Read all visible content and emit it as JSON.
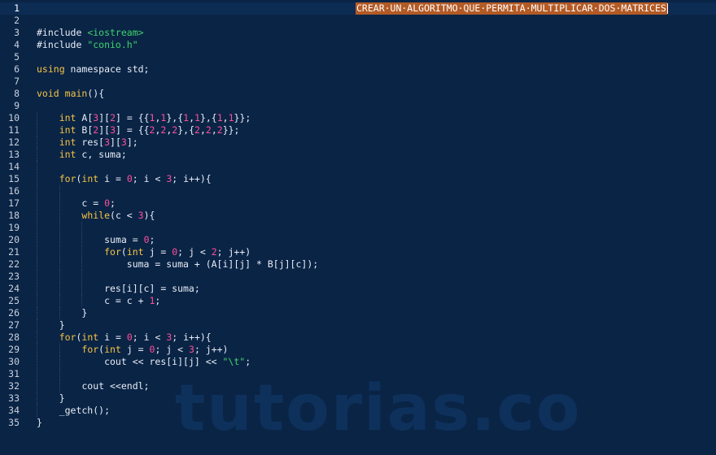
{
  "editor": {
    "selected_comment": "CREAR·UN·ALGORITMO·QUE·PERMITA·MULTIPLICAR·DOS·MATRICES",
    "watermark": "tutorias.co",
    "lines": [
      {
        "n": "1",
        "current": true,
        "html": ""
      },
      {
        "n": "2",
        "html": ""
      },
      {
        "n": "3",
        "html": "<span class=\"pp\">#include </span><span class=\"str\">&lt;iostream&gt;</span>"
      },
      {
        "n": "4",
        "html": "<span class=\"pp\">#include </span><span class=\"str\">\"conio.h\"</span>"
      },
      {
        "n": "5",
        "html": ""
      },
      {
        "n": "6",
        "html": "<span class=\"kw\">using</span> namespace std;"
      },
      {
        "n": "7",
        "html": ""
      },
      {
        "n": "8",
        "html": "<span class=\"kw\">void</span> <span class=\"kw\">main</span>(){"
      },
      {
        "n": "9",
        "html": ""
      },
      {
        "n": "10",
        "guides": 1,
        "html": "    <span class=\"kw\">int</span> A[<span class=\"num\">3</span>][<span class=\"num\">2</span>] = {{<span class=\"num\">1</span>,<span class=\"num\">1</span>},{<span class=\"num\">1</span>,<span class=\"num\">1</span>},{<span class=\"num\">1</span>,<span class=\"num\">1</span>}};"
      },
      {
        "n": "11",
        "guides": 1,
        "html": "    <span class=\"kw\">int</span> B[<span class=\"num\">2</span>][<span class=\"num\">3</span>] = {{<span class=\"num\">2</span>,<span class=\"num\">2</span>,<span class=\"num\">2</span>},{<span class=\"num\">2</span>,<span class=\"num\">2</span>,<span class=\"num\">2</span>}};"
      },
      {
        "n": "12",
        "guides": 1,
        "html": "    <span class=\"kw\">int</span> res[<span class=\"num\">3</span>][<span class=\"num\">3</span>];"
      },
      {
        "n": "13",
        "guides": 1,
        "html": "    <span class=\"kw\">int</span> c, suma;"
      },
      {
        "n": "14",
        "guides": 1,
        "html": ""
      },
      {
        "n": "15",
        "guides": 1,
        "html": "    <span class=\"kw\">for</span>(<span class=\"kw\">int</span> i = <span class=\"num\">0</span>; i &lt; <span class=\"num\">3</span>; i++){"
      },
      {
        "n": "16",
        "guides": 2,
        "html": ""
      },
      {
        "n": "17",
        "guides": 2,
        "html": "        c = <span class=\"num\">0</span>;"
      },
      {
        "n": "18",
        "guides": 2,
        "html": "        <span class=\"kw\">while</span>(c &lt; <span class=\"num\">3</span>){"
      },
      {
        "n": "19",
        "guides": 3,
        "html": ""
      },
      {
        "n": "20",
        "guides": 3,
        "html": "            suma = <span class=\"num\">0</span>;"
      },
      {
        "n": "21",
        "guides": 3,
        "html": "            <span class=\"kw\">for</span>(<span class=\"kw\">int</span> j = <span class=\"num\">0</span>; j &lt; <span class=\"num\">2</span>; j++)"
      },
      {
        "n": "22",
        "guides": 3,
        "html": "                suma = suma + (A[i][j] * B[j][c]);"
      },
      {
        "n": "23",
        "guides": 3,
        "html": ""
      },
      {
        "n": "24",
        "guides": 3,
        "html": "            res[i][c] = suma;"
      },
      {
        "n": "25",
        "guides": 3,
        "html": "            c = c + <span class=\"num\">1</span>;"
      },
      {
        "n": "26",
        "guides": 2,
        "html": "        }"
      },
      {
        "n": "27",
        "guides": 1,
        "html": "    }"
      },
      {
        "n": "28",
        "guides": 1,
        "html": "    <span class=\"kw\">for</span>(<span class=\"kw\">int</span> i = <span class=\"num\">0</span>; i &lt; <span class=\"num\">3</span>; i++){"
      },
      {
        "n": "29",
        "guides": 2,
        "html": "        <span class=\"kw\">for</span>(<span class=\"kw\">int</span> j = <span class=\"num\">0</span>; j &lt; <span class=\"num\">3</span>; j++)"
      },
      {
        "n": "30",
        "guides": 2,
        "html": "            cout &lt;&lt; res[i][j] &lt;&lt; <span class=\"str\">\"\\t\"</span>;"
      },
      {
        "n": "31",
        "guides": 2,
        "html": ""
      },
      {
        "n": "32",
        "guides": 2,
        "html": "        cout &lt;&lt;endl;"
      },
      {
        "n": "33",
        "guides": 1,
        "html": "    }"
      },
      {
        "n": "34",
        "guides": 1,
        "html": "    _getch();"
      },
      {
        "n": "35",
        "html": "}"
      }
    ]
  },
  "colors": {
    "background": "#0a2446",
    "keyword": "#f5c542",
    "number": "#ff4f9a",
    "string": "#3fd46b",
    "text": "#e8eef5",
    "selection": "#b35a25"
  }
}
